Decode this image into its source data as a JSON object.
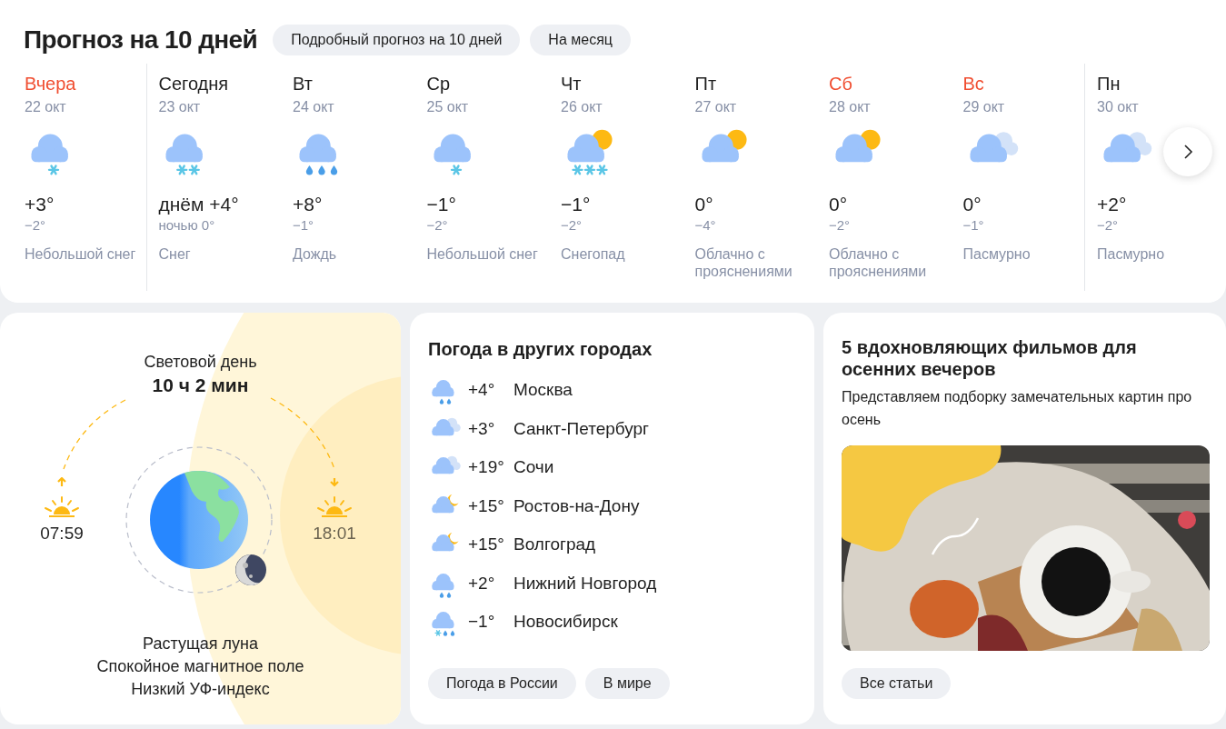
{
  "forecast": {
    "title": "Прогноз на 10 дней",
    "links": [
      "Подробный прогноз на 10 дней",
      "На месяц"
    ],
    "days": [
      {
        "name": "Вчера",
        "date": "22 окт",
        "weekend": true,
        "divider_before": false,
        "kind": "light-snow",
        "temp": "+3°",
        "low": "−2°",
        "condition": "Небольшой снег"
      },
      {
        "name": "Сегодня",
        "date": "23 окт",
        "weekend": false,
        "divider_before": true,
        "kind": "snow",
        "temp": "днём +4°",
        "low": "ночью 0°",
        "condition": "Снег"
      },
      {
        "name": "Вт",
        "date": "24 окт",
        "weekend": false,
        "divider_before": false,
        "kind": "rain",
        "temp": "+8°",
        "low": "−1°",
        "condition": "Дождь"
      },
      {
        "name": "Ср",
        "date": "25 окт",
        "weekend": false,
        "divider_before": false,
        "kind": "light-snow",
        "temp": "−1°",
        "low": "−2°",
        "condition": "Небольшой снег"
      },
      {
        "name": "Чт",
        "date": "26 окт",
        "weekend": false,
        "divider_before": false,
        "kind": "snowfall",
        "temp": "−1°",
        "low": "−2°",
        "condition": "Снегопад"
      },
      {
        "name": "Пт",
        "date": "27 окт",
        "weekend": false,
        "divider_before": false,
        "kind": "partly-cloudy",
        "temp": "0°",
        "low": "−4°",
        "condition": "Облачно с прояснениями"
      },
      {
        "name": "Сб",
        "date": "28 окт",
        "weekend": true,
        "divider_before": false,
        "kind": "partly-cloudy",
        "temp": "0°",
        "low": "−2°",
        "condition": "Облачно с прояснениями"
      },
      {
        "name": "Вс",
        "date": "29 окт",
        "weekend": true,
        "divider_before": false,
        "kind": "overcast",
        "temp": "0°",
        "low": "−1°",
        "condition": "Пасмурно"
      },
      {
        "name": "Пн",
        "date": "30 окт",
        "weekend": false,
        "divider_before": true,
        "kind": "overcast",
        "temp": "+2°",
        "low": "−2°",
        "condition": "Пасмурно"
      }
    ]
  },
  "daylight": {
    "title": "Световой день",
    "duration": "10 ч 2 мин",
    "sunrise": "07:59",
    "sunset": "18:01",
    "notes": [
      "Растущая луна",
      "Спокойное магнитное поле",
      "Низкий УФ-индекс"
    ]
  },
  "cities": {
    "title": "Погода в других городах",
    "items": [
      {
        "kind": "light-rain",
        "temp": "+4°",
        "name": "Москва"
      },
      {
        "kind": "overcast",
        "temp": "+3°",
        "name": "Санкт-Петербург"
      },
      {
        "kind": "overcast",
        "temp": "+19°",
        "name": "Сочи"
      },
      {
        "kind": "partly-cloudy-night",
        "temp": "+15°",
        "name": "Ростов-на-Дону"
      },
      {
        "kind": "partly-cloudy-night",
        "temp": "+15°",
        "name": "Волгоград"
      },
      {
        "kind": "light-rain",
        "temp": "+2°",
        "name": "Нижний Новгород"
      },
      {
        "kind": "sleet",
        "temp": "−1°",
        "name": "Новосибирск"
      }
    ],
    "buttons": [
      "Погода в России",
      "В мире"
    ]
  },
  "article": {
    "title": "5 вдохновляющих фильмов для осенних вечеров",
    "text": "Представляем подборку замечательных картин про осень",
    "button": "Все статьи"
  }
}
